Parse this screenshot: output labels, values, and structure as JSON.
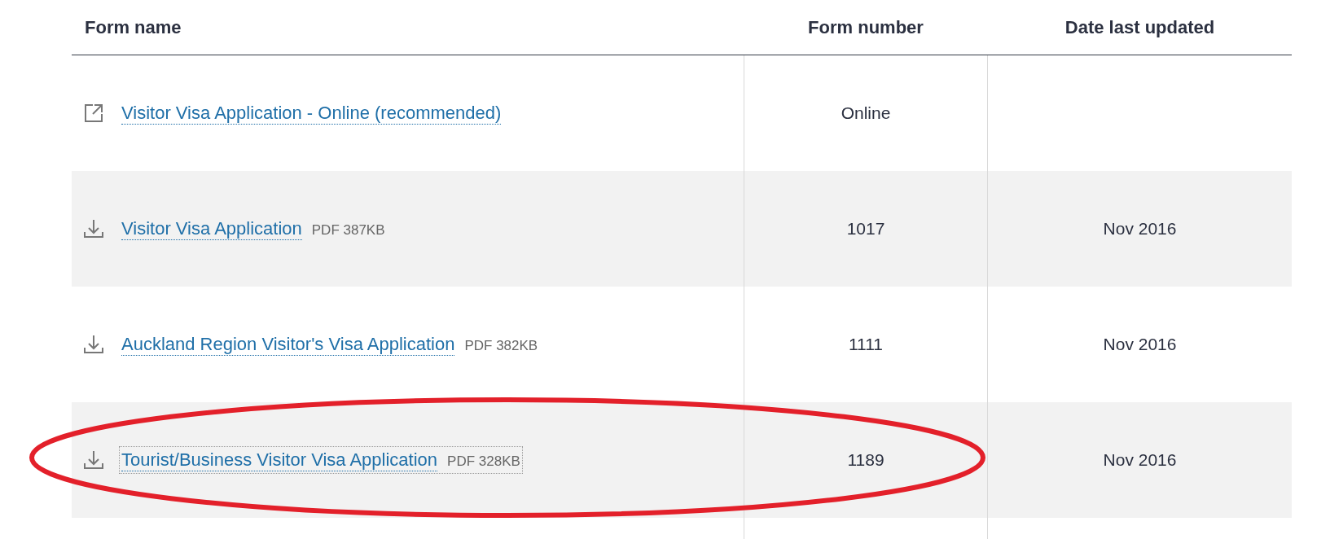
{
  "table": {
    "columns": [
      "Form name",
      "Form number",
      "Date last updated"
    ],
    "rows": [
      {
        "kind": "external",
        "form_name": {
          "link": "Visitor Visa Application - Online (recommended)",
          "focused": false
        },
        "form_number": "Online"
      },
      {
        "kind": "download",
        "form_name": {
          "link": "Visitor Visa Application",
          "file_info": "PDF 387KB",
          "focused": false
        },
        "form_number": "1017",
        "date": "Nov 2016"
      },
      {
        "kind": "download",
        "form_name": {
          "link": "Auckland Region Visitor's Visa Application",
          "file_info": "PDF 382KB",
          "focused": false
        },
        "form_number": "1111",
        "date": "Nov 2016"
      },
      {
        "kind": "download",
        "form_name": {
          "link": "Tourist/Business Visitor Visa Application",
          "file_info": "PDF 328KB",
          "focused": true
        },
        "form_number": "1189",
        "date": "Nov 2016"
      }
    ]
  },
  "annotation": {
    "kind": "ellipse",
    "color": "#e3202a"
  }
}
